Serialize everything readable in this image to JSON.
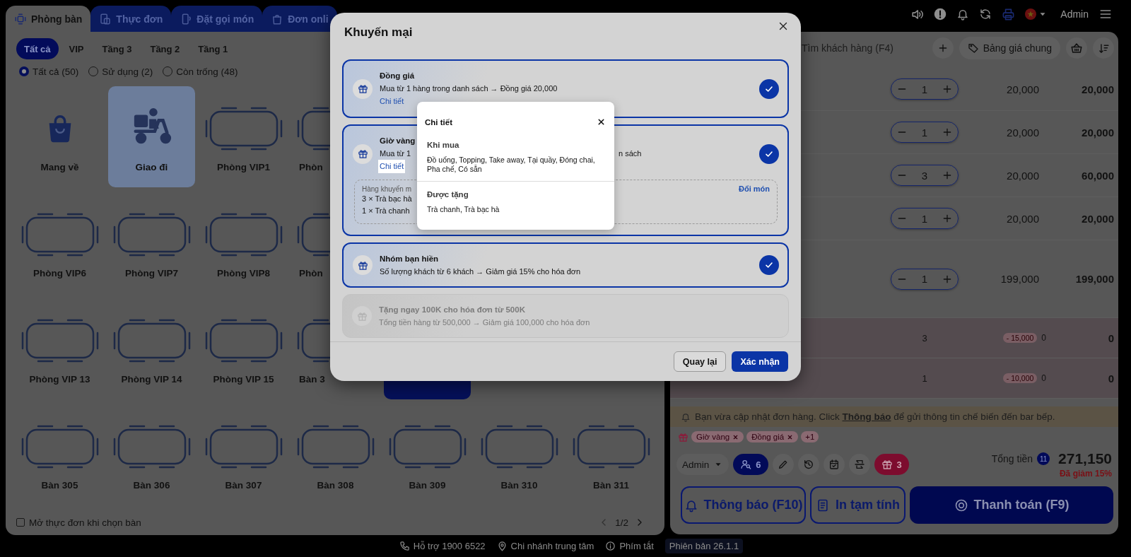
{
  "top_tabs": [
    {
      "label": "Phòng bàn",
      "selected": true
    },
    {
      "label": "Thực đơn",
      "selected": false
    },
    {
      "label": "Đặt gọi món",
      "selected": false
    },
    {
      "label": "Đơn onli",
      "selected": false
    }
  ],
  "header": {
    "user": "Admin"
  },
  "rooms": {
    "filters": [
      {
        "label": "Tất cả",
        "selected": true
      },
      {
        "label": "VIP",
        "selected": false
      },
      {
        "label": "Tầng 3",
        "selected": false
      },
      {
        "label": "Tầng 2",
        "selected": false
      },
      {
        "label": "Tầng 1",
        "selected": false
      }
    ],
    "statuses": [
      {
        "label": "Tất cả (50)",
        "selected": true
      },
      {
        "label": "Sử dụng (2)",
        "selected": false
      },
      {
        "label": "Còn trống (48)",
        "selected": false
      }
    ],
    "grid": [
      [
        {
          "kind": "takeaway",
          "name": "Mang về",
          "selected": false,
          "in_use": false
        },
        {
          "kind": "delivery",
          "name": "Giao đi",
          "selected": true,
          "in_use": false
        },
        {
          "kind": "table",
          "name": "Phòng VIP1",
          "selected": false,
          "in_use": false
        },
        {
          "kind": "table",
          "name": "Phòn",
          "selected": false,
          "in_use": false
        }
      ],
      [
        {
          "kind": "table",
          "name": "Phòng VIP6",
          "selected": false,
          "in_use": false
        },
        {
          "kind": "table",
          "name": "Phòng VIP7",
          "selected": false,
          "in_use": false
        },
        {
          "kind": "table",
          "name": "Phòng VIP8",
          "selected": false,
          "in_use": false
        },
        {
          "kind": "table",
          "name": "Phòn",
          "selected": false,
          "in_use": false
        }
      ],
      [
        {
          "kind": "table",
          "name": "Phòng VIP 13",
          "selected": false,
          "in_use": false
        },
        {
          "kind": "table",
          "name": "Phòng VIP 14",
          "selected": false,
          "in_use": false
        },
        {
          "kind": "table",
          "name": "Phòng VIP 15",
          "selected": false,
          "in_use": false
        },
        {
          "kind": "table",
          "name": "Bàn 3",
          "selected": false,
          "in_use": false
        },
        {
          "kind": "table",
          "selected": false,
          "in_use": true
        }
      ],
      [
        {
          "kind": "table",
          "name": "Bàn 305",
          "selected": false,
          "in_use": false
        },
        {
          "kind": "table",
          "name": "Bàn 306",
          "selected": false,
          "in_use": false
        },
        {
          "kind": "table",
          "name": "Bàn 307",
          "selected": false,
          "in_use": false
        },
        {
          "kind": "table",
          "name": "Bàn 308",
          "selected": false,
          "in_use": false
        },
        {
          "kind": "table",
          "name": "Bàn 309",
          "selected": false,
          "in_use": false
        },
        {
          "kind": "table",
          "name": "Bàn 310",
          "selected": false,
          "in_use": false
        },
        {
          "kind": "table",
          "name": "Bàn 311",
          "selected": false,
          "in_use": false
        }
      ]
    ],
    "open_menu_on_select": {
      "label": "Mở thực đơn khi chọn bàn",
      "checked": false
    },
    "page": "1/2"
  },
  "order": {
    "customer_search": {
      "placeholder": "Tìm khách hàng (F4)"
    },
    "price_list": "Bảng giá chung",
    "lines": [
      {
        "quantity": "1",
        "price": "20,000",
        "total": "20,000"
      },
      {
        "quantity": "1",
        "price": "20,000",
        "total": "20,000"
      },
      {
        "quantity": "3",
        "price": "20,000",
        "total": "60,000"
      },
      {
        "quantity": "1",
        "price": "20,000",
        "total": "20,000"
      },
      {
        "quantity": "1",
        "price": "199,000",
        "total": "199,000"
      }
    ],
    "promo_lines": [
      {
        "quantity": "3",
        "discount": "- 15,000",
        "price": "0",
        "total": "0"
      },
      {
        "quantity": "1",
        "discount": "- 10,000",
        "price": "0",
        "total": "0"
      }
    ],
    "notice": {
      "before": "Bạn vừa cập nhật đơn hàng. Click",
      "link": "Thông báo",
      "after": "để gửi thông tin chế biến đến bar bếp."
    },
    "applied_promotions": [
      {
        "label": "Giờ vàng"
      },
      {
        "label": "Đồng giá"
      }
    ],
    "more_promotions": "+1",
    "staff": "Admin",
    "guest_count": "6",
    "gift_count": "3",
    "total_label": "Tổng tiền",
    "item_count": "11",
    "total": "271,150",
    "discount_note": "Đã giảm 15%",
    "buttons": [
      {
        "kind": "notify",
        "label": "Thông báo (F10)"
      },
      {
        "kind": "print",
        "label": "In tạm tính"
      },
      {
        "kind": "pay",
        "label": "Thanh toán (F9)"
      }
    ]
  },
  "promotion_dialog": {
    "title": "Khuyến mại",
    "promotions": [
      {
        "title": "Đồng giá",
        "description": "Mua từ 1 hàng trong danh sách → Đồng giá 20,000",
        "link": "Chi tiết",
        "link_active": false,
        "selected": true,
        "disabled": false
      },
      {
        "title": "Giờ vàng",
        "description": "Mua từ 1",
        "description_tail": "n sách",
        "link": "Chi tiết",
        "link_active": true,
        "selected": true,
        "disabled": false,
        "gift_items": {
          "label": "Hàng khuyến m",
          "action": "Đổi món",
          "lines": [
            "3 × Trà bạc hà",
            "1 × Trà chanh"
          ]
        }
      },
      {
        "title": "Nhóm bạn hiền",
        "description": "Số lượng khách từ 6 khách → Giảm giá 15% cho hóa đơn",
        "selected": true,
        "disabled": false
      },
      {
        "title": "Tặng ngay 100K cho hóa đơn từ 500K",
        "description": "Tổng tiền hàng từ 500,000 → Giảm giá 100,000 cho hóa đơn",
        "selected": false,
        "disabled": true
      }
    ],
    "detail_popover": {
      "title": "Chi tiết",
      "sections": [
        {
          "heading": "Khi mua",
          "text": "Đồ uống, Topping, Take away, Tại quầy, Đóng chai, Pha chế, Có sẵn"
        },
        {
          "heading": "Được tặng",
          "text": "Trà chanh, Trà bạc hà"
        }
      ]
    },
    "buttons": [
      {
        "kind": "secondary",
        "label": "Quay lại"
      },
      {
        "kind": "primary",
        "label": "Xác nhận"
      }
    ]
  },
  "footer": [
    {
      "kind": "phone",
      "label": "Hỗ trợ 1900 6522"
    },
    {
      "kind": "branch",
      "label": "Chi nhánh trung tâm"
    },
    {
      "kind": "shortcuts",
      "label": "Phím tắt"
    },
    {
      "kind": "version",
      "label": "Phiên bản 26.1.1"
    }
  ]
}
